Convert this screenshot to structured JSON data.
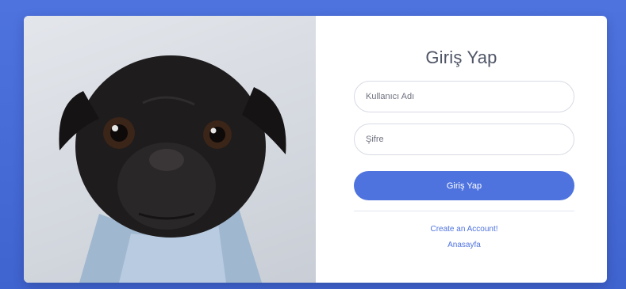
{
  "login": {
    "title": "Giriş Yap",
    "username_placeholder": "Kullanıcı Adı",
    "password_placeholder": "Şifre",
    "submit_label": "Giriş Yap",
    "create_account_link": "Create an Account!",
    "home_link": "Anasayfa"
  },
  "colors": {
    "page_background": "#4e73df",
    "primary_button": "#4e73df",
    "link": "#4e73df",
    "title_text": "#4f5566"
  },
  "images": {
    "hero": "pug-dog-photo"
  }
}
